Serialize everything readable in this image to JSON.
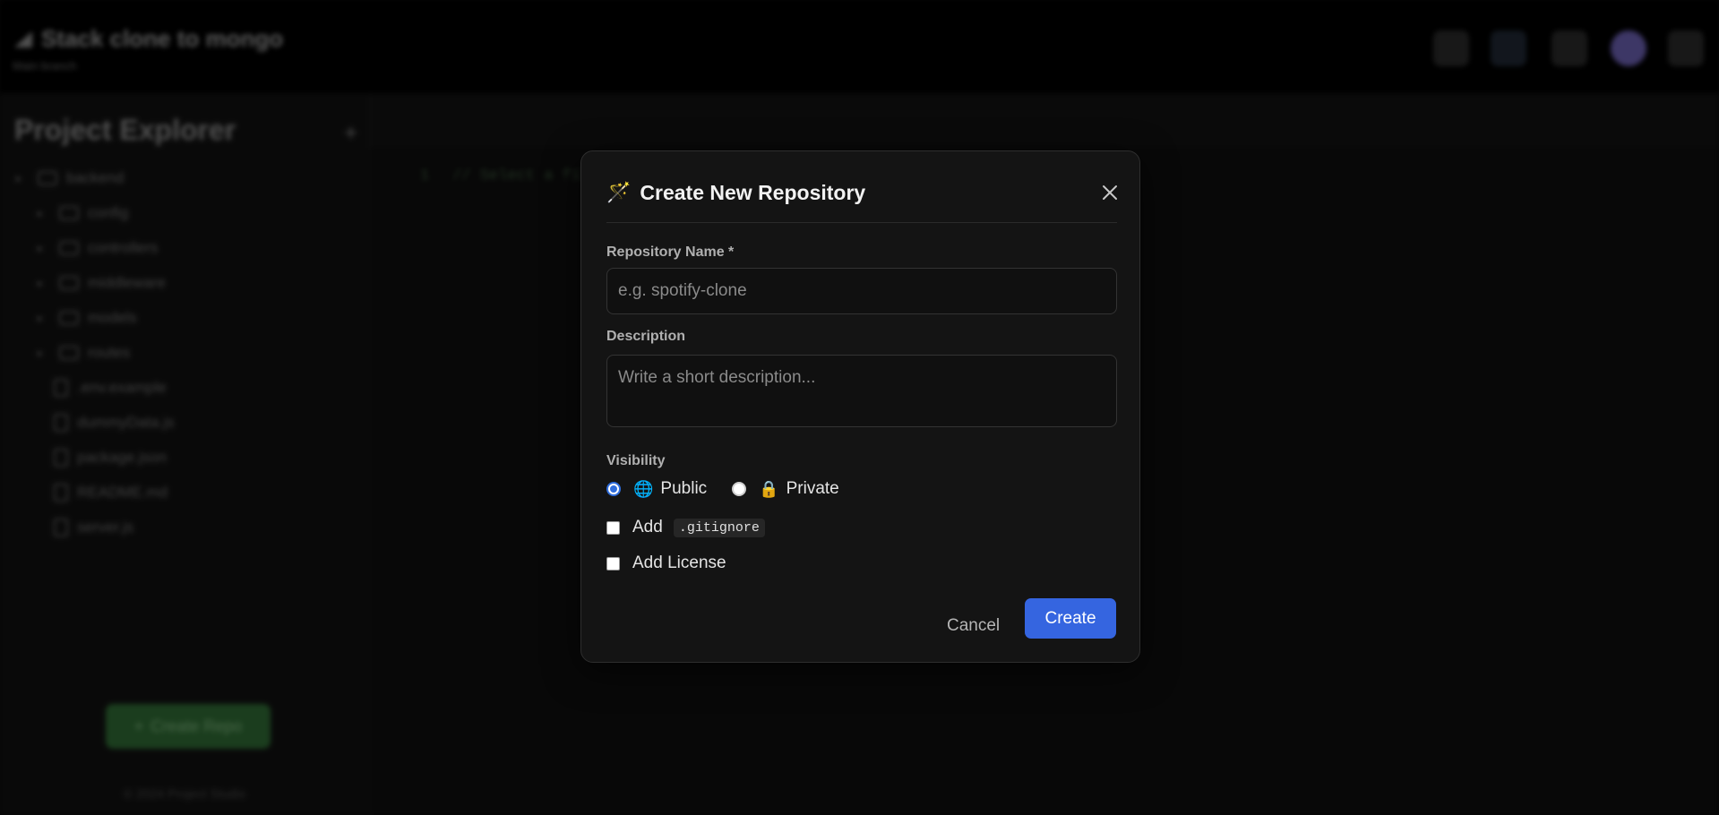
{
  "app": {
    "brand": {
      "title": "Stack clone to mongo",
      "subtitle": "Main branch"
    },
    "sidebar": {
      "title": "Project Explorer",
      "tree": [
        {
          "name": "backend",
          "type": "folder",
          "depth": 0
        },
        {
          "name": "config",
          "type": "folder",
          "depth": 1
        },
        {
          "name": "controllers",
          "type": "folder",
          "depth": 1
        },
        {
          "name": "middleware",
          "type": "folder",
          "depth": 1
        },
        {
          "name": "models",
          "type": "folder",
          "depth": 1
        },
        {
          "name": "routes",
          "type": "folder",
          "depth": 1
        },
        {
          "name": ".env.example",
          "type": "file",
          "depth": 1
        },
        {
          "name": "dummyData.js",
          "type": "file",
          "depth": 1
        },
        {
          "name": "package.json",
          "type": "file",
          "depth": 1
        },
        {
          "name": "README.md",
          "type": "file",
          "depth": 1
        },
        {
          "name": "server.js",
          "type": "file",
          "depth": 1
        }
      ],
      "create_button": "Create Repo",
      "footer": "© 2024 Project Studio"
    },
    "editor": {
      "line_number": "1",
      "line_text": "// Select a file"
    }
  },
  "modal": {
    "icon": "🪄",
    "title": "Create New Repository",
    "close_icon": "close-icon",
    "name_label": "Repository Name *",
    "name_placeholder": "e.g. spotify-clone",
    "name_value": "",
    "description_label": "Description",
    "description_placeholder": "Write a short description...",
    "description_value": "",
    "visibility_label": "Visibility",
    "visibility_options": [
      {
        "icon": "🌐",
        "label": "Public",
        "checked": true
      },
      {
        "icon": "🔒",
        "label": "Private",
        "checked": false
      }
    ],
    "gitignore_prefix": "Add",
    "gitignore_code": ".gitignore",
    "gitignore_checked": false,
    "license_label": "Add License",
    "license_checked": false,
    "cancel_label": "Cancel",
    "create_label": "Create",
    "accent_color": "#3565e0"
  }
}
